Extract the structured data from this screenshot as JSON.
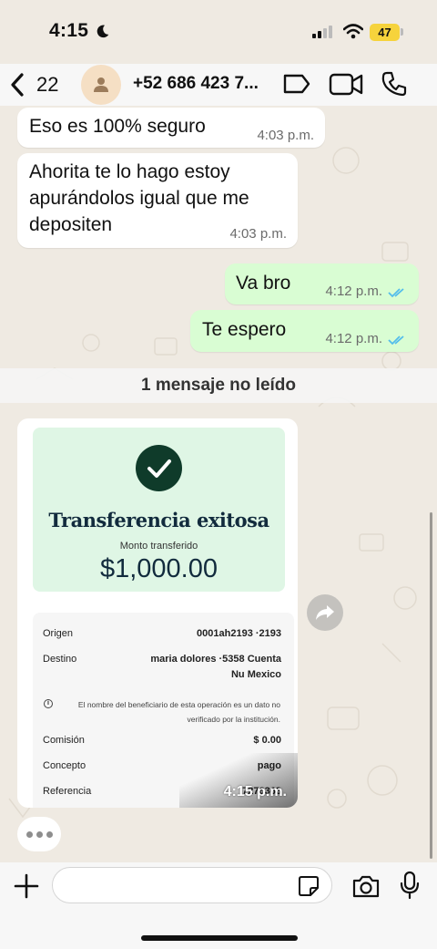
{
  "status_bar": {
    "time": "4:15",
    "battery": "47"
  },
  "header": {
    "back_count": "22",
    "contact_name": "+52 686 423 7..."
  },
  "messages": [
    {
      "text": "Eso es 100% seguro",
      "time": "4:03 p.m."
    },
    {
      "text": "Ahorita te lo hago estoy apurándolos igual que me depositen",
      "time": "4:03 p.m."
    },
    {
      "text": "Va bro",
      "time": "4:12 p.m."
    },
    {
      "text": "Te espero",
      "time": "4:12 p.m."
    }
  ],
  "unread_label": "1 mensaje no leído",
  "receipt": {
    "title": "Transferencia exitosa",
    "subtitle": "Monto transferido",
    "amount": "$1,000.00",
    "rows": [
      {
        "label": "Origen",
        "value": "0001ah2193 ·2193"
      },
      {
        "label": "Destino",
        "value": "maria dolores ·5358 Cuenta",
        "value2": "Nu Mexico"
      },
      {
        "label": "Comisión",
        "value": "$ 0.00"
      },
      {
        "label": "Concepto",
        "value": "pago"
      },
      {
        "label": "Referencia",
        "value": "7276363"
      }
    ],
    "note_line1": "El nombre del beneficiario de esta operación es un dato no",
    "note_line2": "verificado por la institución.",
    "time": "4:15 p.m."
  },
  "input": {
    "value": "",
    "placeholder": ""
  },
  "colors": {
    "outgoing_bubble": "#d9fdd3",
    "incoming_bubble": "#ffffff",
    "chat_background": "#efeae2",
    "read_ticks": "#53bdeb"
  },
  "icons": [
    "moon-icon",
    "signal-icon",
    "wifi-icon",
    "back-icon",
    "person-icon",
    "label-icon",
    "video-call-icon",
    "phone-icon",
    "check-icon",
    "forward-icon",
    "plus-icon",
    "sticker-icon",
    "camera-icon",
    "mic-icon"
  ]
}
